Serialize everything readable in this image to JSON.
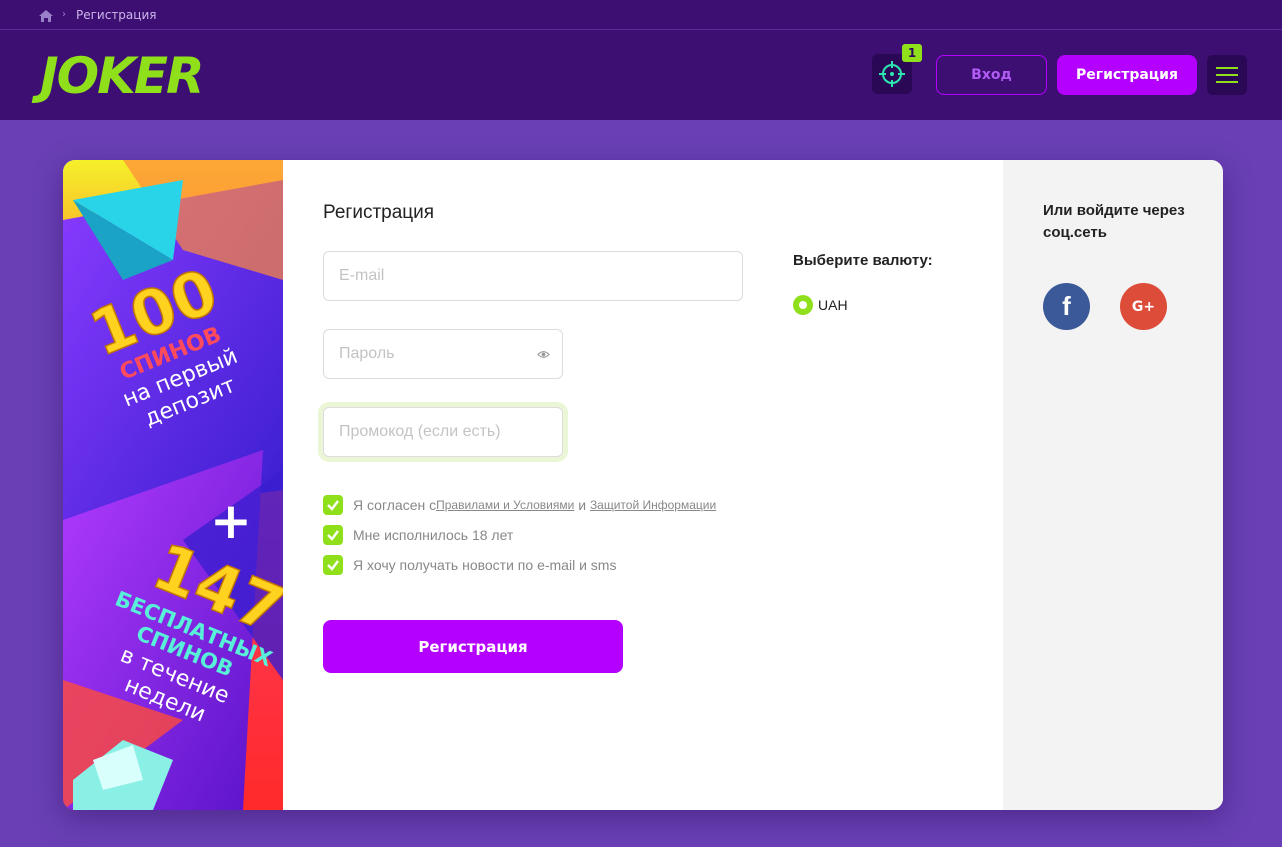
{
  "breadcrumb": {
    "current": "Регистрация"
  },
  "header": {
    "logo_text": "JOKER",
    "target_badge": "1",
    "login_label": "Вход",
    "register_label": "Регистрация"
  },
  "promo": {
    "line1": "100",
    "line2": "СПИНОВ",
    "line3": "на первый",
    "line4": "депозит",
    "plus": "+",
    "line5": "147",
    "line6": "БЕСПЛАТНЫХ",
    "line7": "СПИНОВ",
    "line8": "в течение",
    "line9": "недели"
  },
  "form": {
    "title": "Регистрация",
    "email_placeholder": "E-mail",
    "password_placeholder": "Пароль",
    "promo_placeholder": "Промокод (если есть)",
    "currency_title": "Выберите валюту:",
    "currency_option": "UAH",
    "agree_prefix": "Я согласен с ",
    "terms_link": "Правилами и Условиями",
    "agree_and": " и ",
    "privacy_link": "Защитой Информации",
    "age_label": "Мне исполнилось 18 лет",
    "news_label": "Я хочу получать новости по e-mail и sms",
    "submit_label": "Регистрация"
  },
  "social": {
    "title": "Или войдите через соц.сеть",
    "facebook_glyph": "f",
    "google_glyph": "G+"
  },
  "colors": {
    "brand_green": "#8fe01b",
    "accent_purple": "#b400ff",
    "header_bg": "#3e0f72",
    "page_bg": "#6a3fb5"
  }
}
